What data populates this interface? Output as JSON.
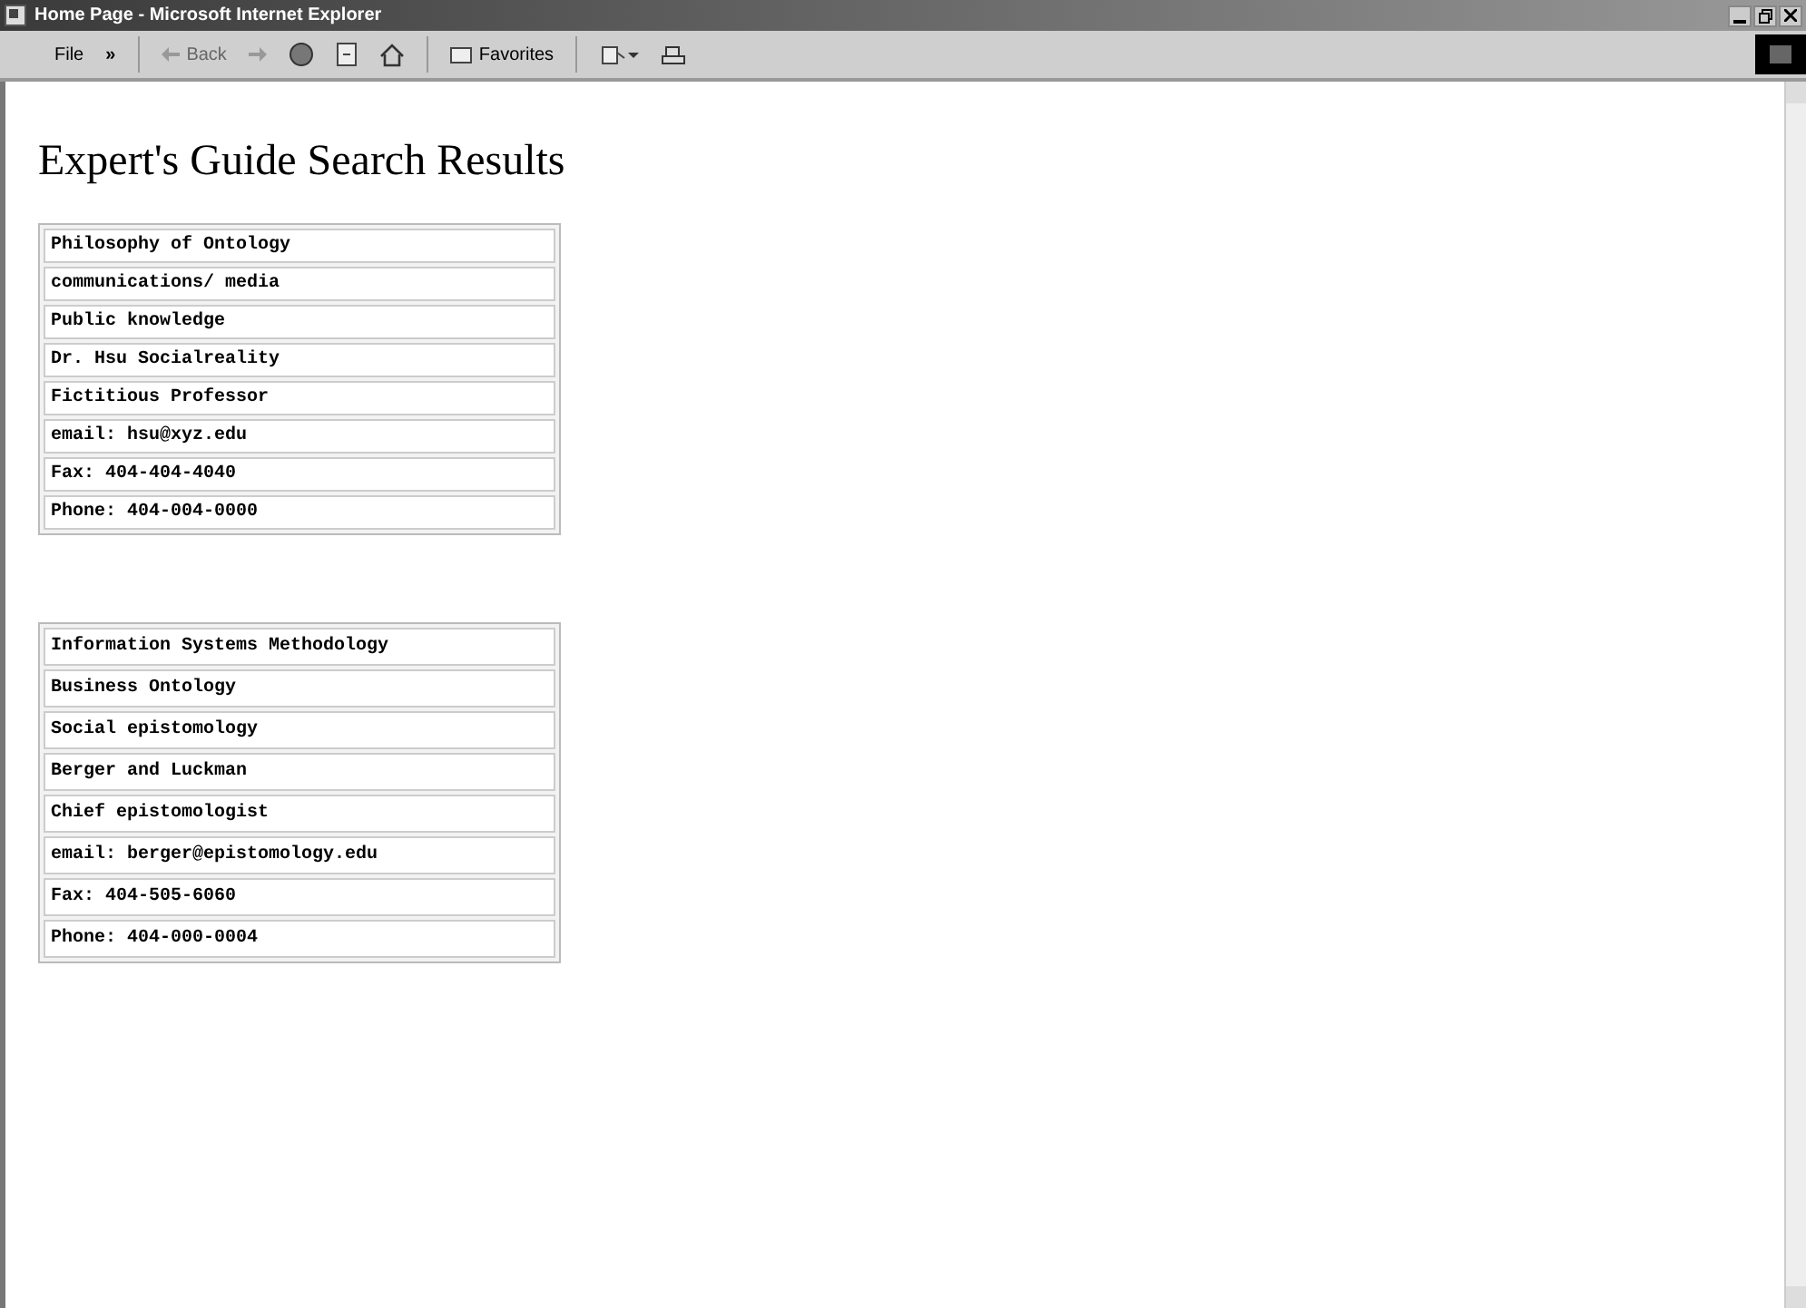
{
  "window": {
    "title": "Home Page - Microsoft Internet Explorer"
  },
  "toolbar": {
    "menu": "File",
    "more": "»",
    "back": {
      "label": "Back",
      "disabled": true
    },
    "favorites": "Favorites"
  },
  "page": {
    "heading": "Expert's Guide Search Results",
    "tables": [
      {
        "rows": [
          "Philosophy of Ontology",
          "communications/ media",
          "Public knowledge",
          "Dr. Hsu Socialreality",
          "Fictitious Professor",
          "email: hsu@xyz.edu",
          "Fax: 404-404-4040",
          "Phone: 404-004-0000"
        ]
      },
      {
        "rows": [
          "Information Systems Methodology",
          "Business Ontology",
          "Social epistomology",
          "Berger and Luckman",
          "Chief epistomologist",
          "email: berger@epistomology.edu",
          "Fax: 404-505-6060",
          "Phone: 404-000-0004"
        ]
      }
    ]
  }
}
